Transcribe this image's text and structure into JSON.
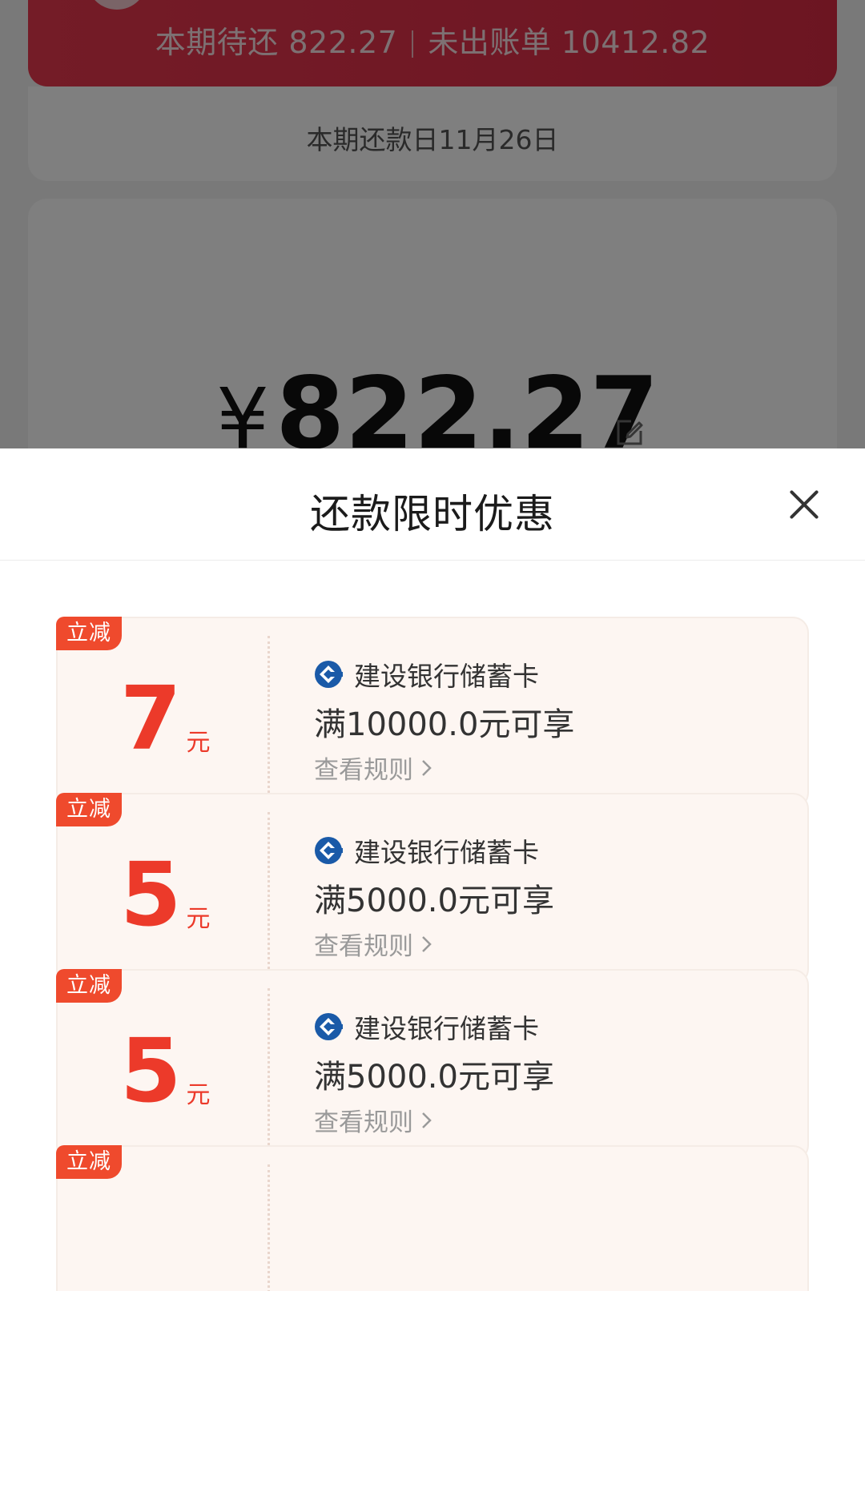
{
  "background": {
    "summary": {
      "current_due_label": "本期待还 822.27",
      "unbilled_label": "未出账单 10412.82"
    },
    "due_date": "本期还款日11月26日",
    "amount": {
      "currency": "¥",
      "value": "822.27"
    }
  },
  "sheet": {
    "title": "还款限时优惠",
    "coupons": [
      {
        "badge": "立减",
        "amount": "7",
        "unit": "元",
        "bank": "建设银行储蓄卡",
        "condition": "满10000.0元可享",
        "rules_label": "查看规则"
      },
      {
        "badge": "立减",
        "amount": "5",
        "unit": "元",
        "bank": "建设银行储蓄卡",
        "condition": "满5000.0元可享",
        "rules_label": "查看规则"
      },
      {
        "badge": "立减",
        "amount": "5",
        "unit": "元",
        "bank": "建设银行储蓄卡",
        "condition": "满5000.0元可享",
        "rules_label": "查看规则"
      },
      {
        "badge": "立减"
      }
    ]
  },
  "colors": {
    "accent_red": "#ec3a2a",
    "badge_red": "#ef4a2d",
    "card_red": "#e1304a",
    "bank_blue": "#1a5aa8",
    "coupon_bg": "#fdf6f2"
  }
}
